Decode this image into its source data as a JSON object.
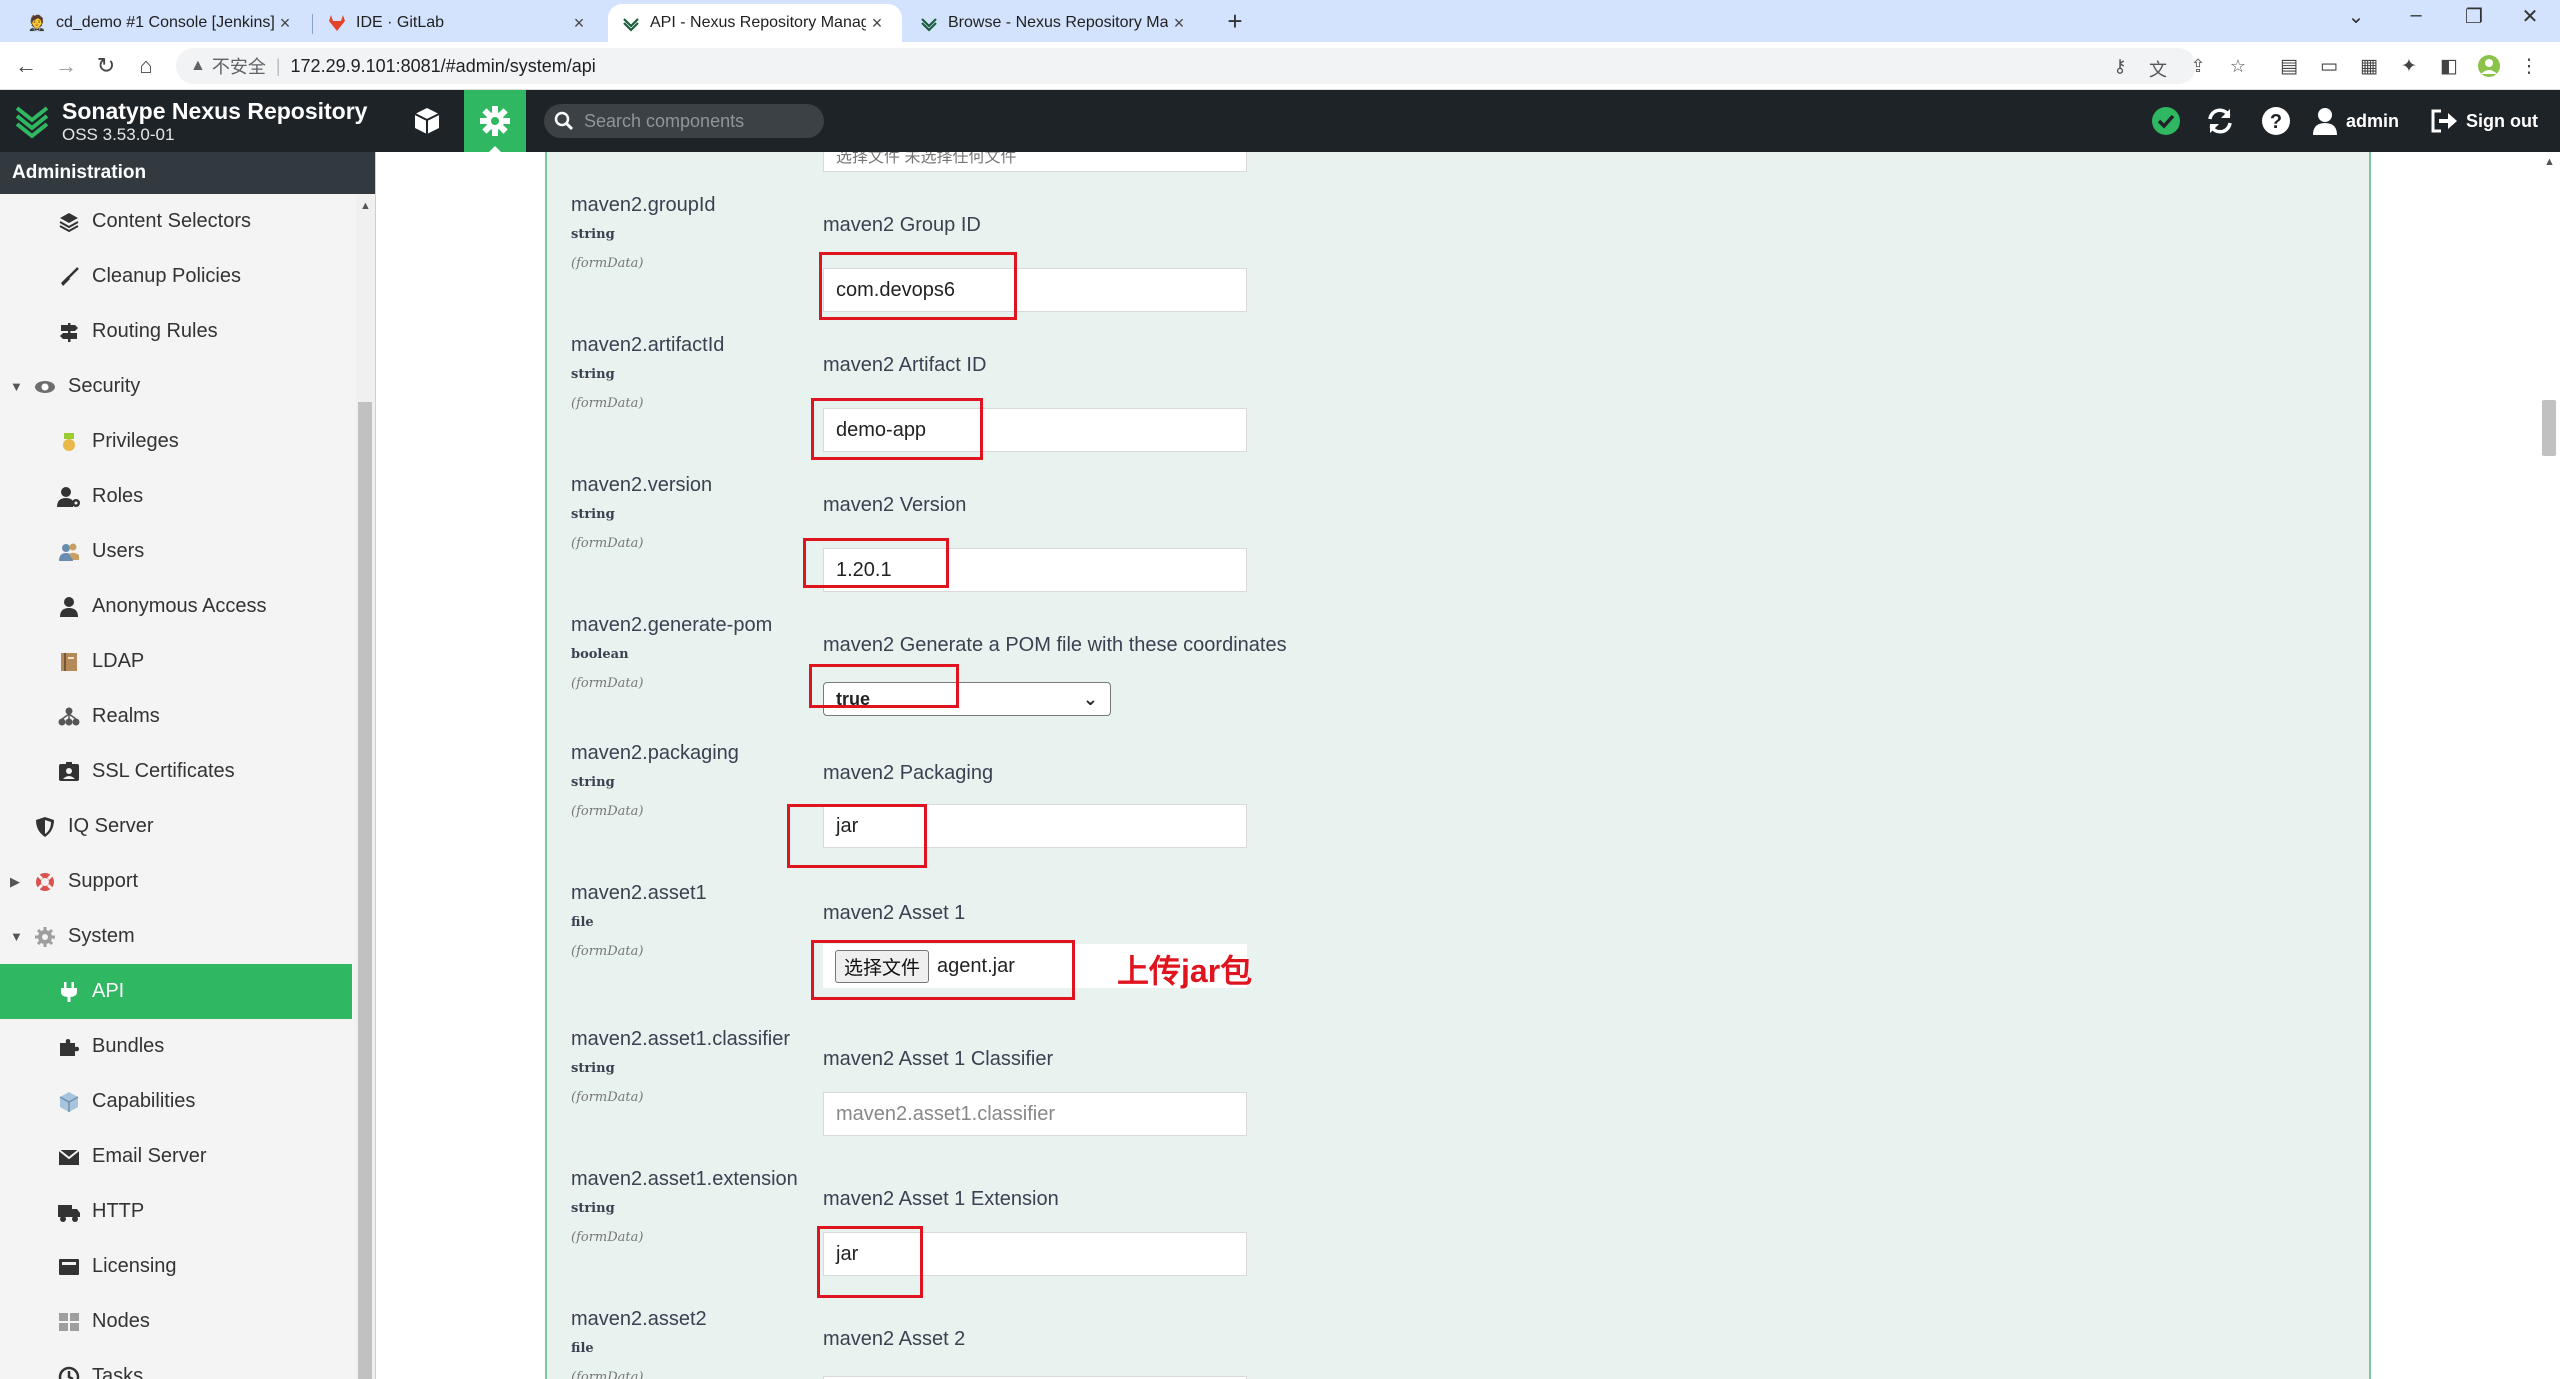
{
  "browser": {
    "tabs": [
      {
        "title": "cd_demo #1 Console [Jenkins]",
        "active": false
      },
      {
        "title": "IDE · GitLab",
        "active": false
      },
      {
        "title": "API - Nexus Repository Manager",
        "active": true
      },
      {
        "title": "Browse - Nexus Repository Manager",
        "active": false
      }
    ],
    "insecure_label": "不安全",
    "url": "172.29.9.101:8081/#admin/system/api"
  },
  "header": {
    "title": "Sonatype Nexus Repository",
    "version": "OSS 3.53.0-01",
    "search_placeholder": "Search components",
    "user": "admin",
    "signout": "Sign out"
  },
  "sidebar": {
    "title": "Administration",
    "items": [
      {
        "label": "Content Selectors",
        "icon": "layers-icon",
        "level": 1
      },
      {
        "label": "Cleanup Policies",
        "icon": "broom-icon",
        "level": 1
      },
      {
        "label": "Routing Rules",
        "icon": "signpost-icon",
        "level": 1
      },
      {
        "label": "Security",
        "icon": "eye-icon",
        "level": 0,
        "expanded": true
      },
      {
        "label": "Privileges",
        "icon": "medal-icon",
        "level": 1
      },
      {
        "label": "Roles",
        "icon": "user-cog-icon",
        "level": 1
      },
      {
        "label": "Users",
        "icon": "users-icon",
        "level": 1
      },
      {
        "label": "Anonymous Access",
        "icon": "user-icon",
        "level": 1
      },
      {
        "label": "LDAP",
        "icon": "book-icon",
        "level": 1
      },
      {
        "label": "Realms",
        "icon": "sitemap-icon",
        "level": 1
      },
      {
        "label": "SSL Certificates",
        "icon": "id-card-icon",
        "level": 1
      },
      {
        "label": "IQ Server",
        "icon": "shield-icon",
        "level": 0
      },
      {
        "label": "Support",
        "icon": "lifebuoy-icon",
        "level": 0,
        "expanded": false
      },
      {
        "label": "System",
        "icon": "gear-icon",
        "level": 0,
        "expanded": true
      },
      {
        "label": "API",
        "icon": "plug-icon",
        "level": 1,
        "active": true
      },
      {
        "label": "Bundles",
        "icon": "puzzle-icon",
        "level": 1
      },
      {
        "label": "Capabilities",
        "icon": "cube-icon",
        "level": 1
      },
      {
        "label": "Email Server",
        "icon": "envelope-icon",
        "level": 1
      },
      {
        "label": "HTTP",
        "icon": "truck-icon",
        "level": 1
      },
      {
        "label": "Licensing",
        "icon": "license-icon",
        "level": 1
      },
      {
        "label": "Nodes",
        "icon": "nodes-icon",
        "level": 1
      },
      {
        "label": "Tasks",
        "icon": "clock-icon",
        "level": 1
      }
    ]
  },
  "params": [
    {
      "name": "maven2.groupId",
      "type": "string",
      "in": "(formData)",
      "description": "maven2 Group ID",
      "kind": "text",
      "value": "com.devops6"
    },
    {
      "name": "maven2.artifactId",
      "type": "string",
      "in": "(formData)",
      "description": "maven2 Artifact ID",
      "kind": "text",
      "value": "demo-app"
    },
    {
      "name": "maven2.version",
      "type": "string",
      "in": "(formData)",
      "description": "maven2 Version",
      "kind": "text",
      "value": "1.20.1"
    },
    {
      "name": "maven2.generate-pom",
      "type": "boolean",
      "in": "(formData)",
      "description": "maven2 Generate a POM file with these coordinates",
      "kind": "select",
      "value": "true"
    },
    {
      "name": "maven2.packaging",
      "type": "string",
      "in": "(formData)",
      "description": "maven2 Packaging",
      "kind": "text",
      "value": "jar"
    },
    {
      "name": "maven2.asset1",
      "type": "file",
      "in": "(formData)",
      "description": "maven2 Asset 1",
      "kind": "file",
      "button": "选择文件",
      "value": "agent.jar"
    },
    {
      "name": "maven2.asset1.classifier",
      "type": "string",
      "in": "(formData)",
      "description": "maven2 Asset 1 Classifier",
      "kind": "text",
      "value": "",
      "placeholder": "maven2.asset1.classifier"
    },
    {
      "name": "maven2.asset1.extension",
      "type": "string",
      "in": "(formData)",
      "description": "maven2 Asset 1 Extension",
      "kind": "text",
      "value": "jar"
    },
    {
      "name": "maven2.asset2",
      "type": "file",
      "in": "(formData)",
      "description": "maven2 Asset 2",
      "kind": "file-cut"
    }
  ],
  "partial_top_field": "选择文件 未选择任何文件",
  "annotation": "上传jar包",
  "colors": {
    "accent": "#2fb761",
    "header": "#1e2327",
    "highlight": "#e0141e",
    "panel": "#e8f3ef"
  }
}
